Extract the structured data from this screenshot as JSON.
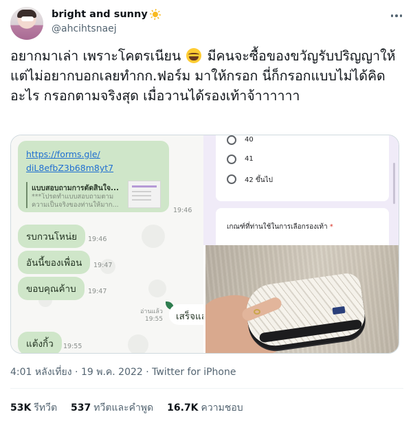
{
  "author": {
    "name": "bright and sunny",
    "name_icon": "sun-icon",
    "handle": "@ahcihtsnaej"
  },
  "tweet": {
    "text_part1": "อยากมาเล่า เพราะโคตรเนียน ",
    "emoji": "face-with-tears-of-joy",
    "text_part2": " มีคนจะซื้อของขวัญรับปริญญาให้ แต่ไม่อยากบอกเลยทำกก.ฟอร์ม มาให้กรอก นี่ก็กรอกแบบไม่ได้คิดอะไร กรอกตามจริงสุด เมื่อวานได้รองเท้าจ้าาาาาา"
  },
  "media": {
    "chat": {
      "link_line1": "https://forms.gle/",
      "link_line2": "diL8efbZ3b68m8yt7",
      "preview_title": "แบบสอบถามการตัดสินใจ...",
      "preview_sub1": "***โปรดทำแบบสอบถามตาม",
      "preview_sub2": "ความเป็นจริงของท่านให้มาก...",
      "times": [
        "19:46",
        "19:46",
        "19:47",
        "19:47",
        "19:55",
        "19:55"
      ],
      "messages": [
        "รบกวนโหน่ย",
        "อันนี้ของเพื่อน",
        "ขอบคุณค้าบ",
        "แต้งกิ้ว"
      ],
      "read_label_1": "อ่านแล้ว",
      "reply_partial": "เสร็จแล"
    },
    "form": {
      "options": [
        "40",
        "41",
        "42 ขึ้นไป"
      ],
      "question": "เกณฑ์ที่ท่านใช้ในการเลือกรองเท้า",
      "required_mark": "*"
    }
  },
  "meta": {
    "time": "4:01 หลังเที่ยง",
    "separator1": " · ",
    "date": "19 พ.ค. 2022",
    "separator2": " · ",
    "source": "Twitter for iPhone"
  },
  "stats": {
    "retweets_count": "53K",
    "retweets_label": "รีทวีต",
    "quotes_count": "537",
    "quotes_label": "ทวีตและคำพูด",
    "likes_count": "16.7K",
    "likes_label": "ความชอบ"
  }
}
